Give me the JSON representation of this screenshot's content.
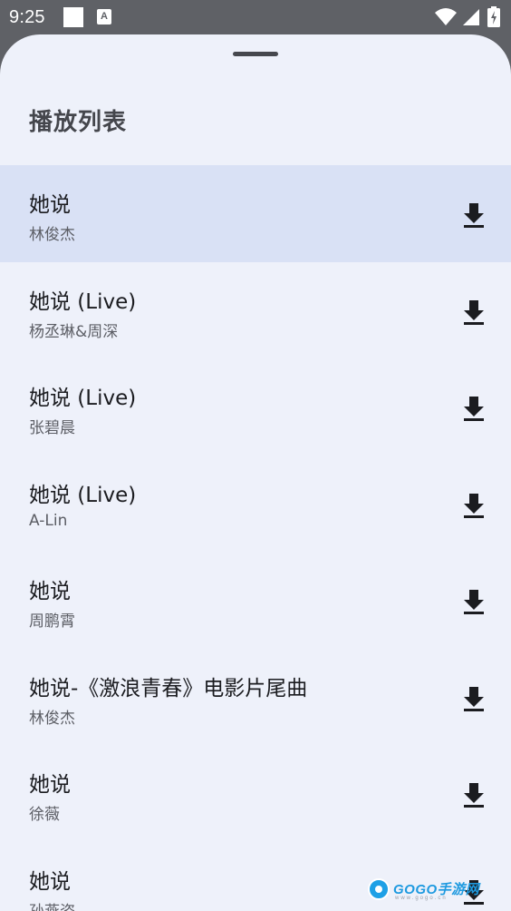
{
  "status_bar": {
    "time": "9:25",
    "notification_icon": "A"
  },
  "sheet": {
    "title": "播放列表"
  },
  "songs": [
    {
      "title": "她说",
      "artist": "林俊杰",
      "active": true
    },
    {
      "title": "她说 (Live)",
      "artist": "杨丞琳&周深"
    },
    {
      "title": "她说 (Live)",
      "artist": "张碧晨"
    },
    {
      "title": "她说 (Live)",
      "artist": "A-Lin"
    },
    {
      "title": "她说",
      "artist": "周鹏霄"
    },
    {
      "title": "她说-《激浪青春》电影片尾曲",
      "artist": "林俊杰"
    },
    {
      "title": "她说",
      "artist": "徐薇"
    },
    {
      "title": "她说",
      "artist": "孙燕姿"
    }
  ],
  "watermark": {
    "brand": "GOGO手游网",
    "domain": "www.gogo.cn"
  },
  "colors": {
    "sheet_background": "#eef1fa",
    "active_row": "#d9e1f5",
    "status_bar": "#5f6166",
    "title_text": "#1b1c20",
    "artist_text": "#5c5e65"
  },
  "icons": {
    "download": "download-icon",
    "wifi": "wifi-icon",
    "cell": "cell-signal-icon",
    "battery": "battery-icon"
  }
}
